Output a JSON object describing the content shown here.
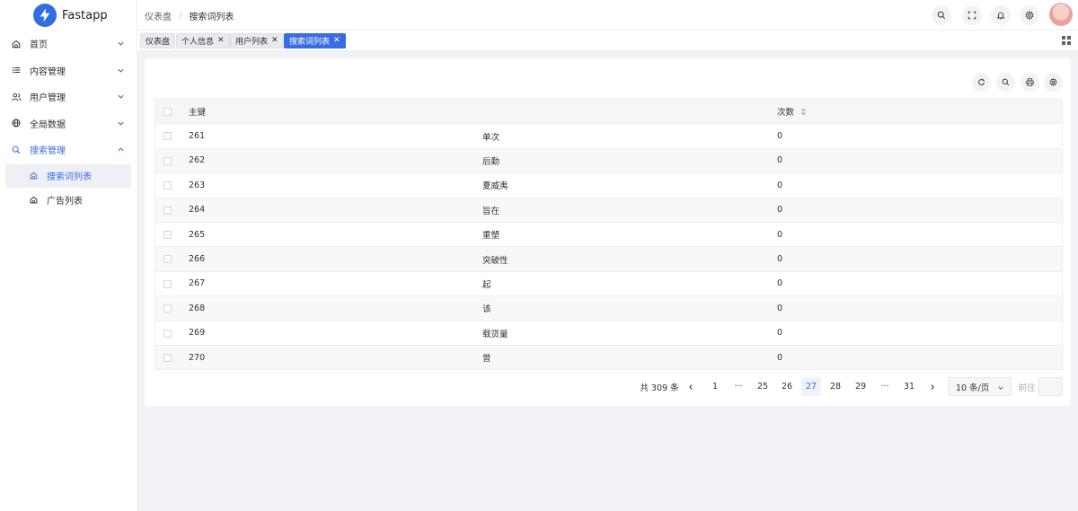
{
  "app": {
    "name": "Fastapp"
  },
  "sidebar": {
    "items": [
      {
        "label": "首页",
        "icon": "home-icon"
      },
      {
        "label": "内容管理",
        "icon": "list-icon"
      },
      {
        "label": "用户管理",
        "icon": "users-icon"
      },
      {
        "label": "全局数据",
        "icon": "globe-icon"
      },
      {
        "label": "搜索管理",
        "icon": "search-icon"
      }
    ],
    "sub_items": [
      {
        "label": "搜索词列表",
        "active": true
      },
      {
        "label": "广告列表",
        "active": false
      }
    ]
  },
  "header": {
    "breadcrumb": [
      "仪表盘",
      "搜索词列表"
    ],
    "separator": "/"
  },
  "tabs": [
    {
      "label": "仪表盘",
      "closable": false
    },
    {
      "label": "个人信息",
      "closable": true
    },
    {
      "label": "用户列表",
      "closable": true
    },
    {
      "label": "搜索词列表",
      "closable": true,
      "active": true
    }
  ],
  "table": {
    "columns": [
      "主键",
      "",
      "次数"
    ],
    "rows": [
      {
        "id": "261",
        "keyword": "单次",
        "count": "0"
      },
      {
        "id": "262",
        "keyword": "后勤",
        "count": "0"
      },
      {
        "id": "263",
        "keyword": "夏威夷",
        "count": "0"
      },
      {
        "id": "264",
        "keyword": "旨在",
        "count": "0"
      },
      {
        "id": "265",
        "keyword": "重塑",
        "count": "0"
      },
      {
        "id": "266",
        "keyword": "突破性",
        "count": "0"
      },
      {
        "id": "267",
        "keyword": "起",
        "count": "0"
      },
      {
        "id": "268",
        "keyword": "该",
        "count": "0"
      },
      {
        "id": "269",
        "keyword": "载货量",
        "count": "0"
      },
      {
        "id": "270",
        "keyword": "曾",
        "count": "0"
      }
    ]
  },
  "pagination": {
    "total": "共 309 条",
    "pages": [
      "1",
      "···",
      "25",
      "26",
      "27",
      "28",
      "29",
      "···",
      "31"
    ],
    "current": "27",
    "page_size": "10 条/页",
    "goto": "前往"
  },
  "colors": {
    "accent": "#3a6de0",
    "bg": "#f0f2f5"
  }
}
